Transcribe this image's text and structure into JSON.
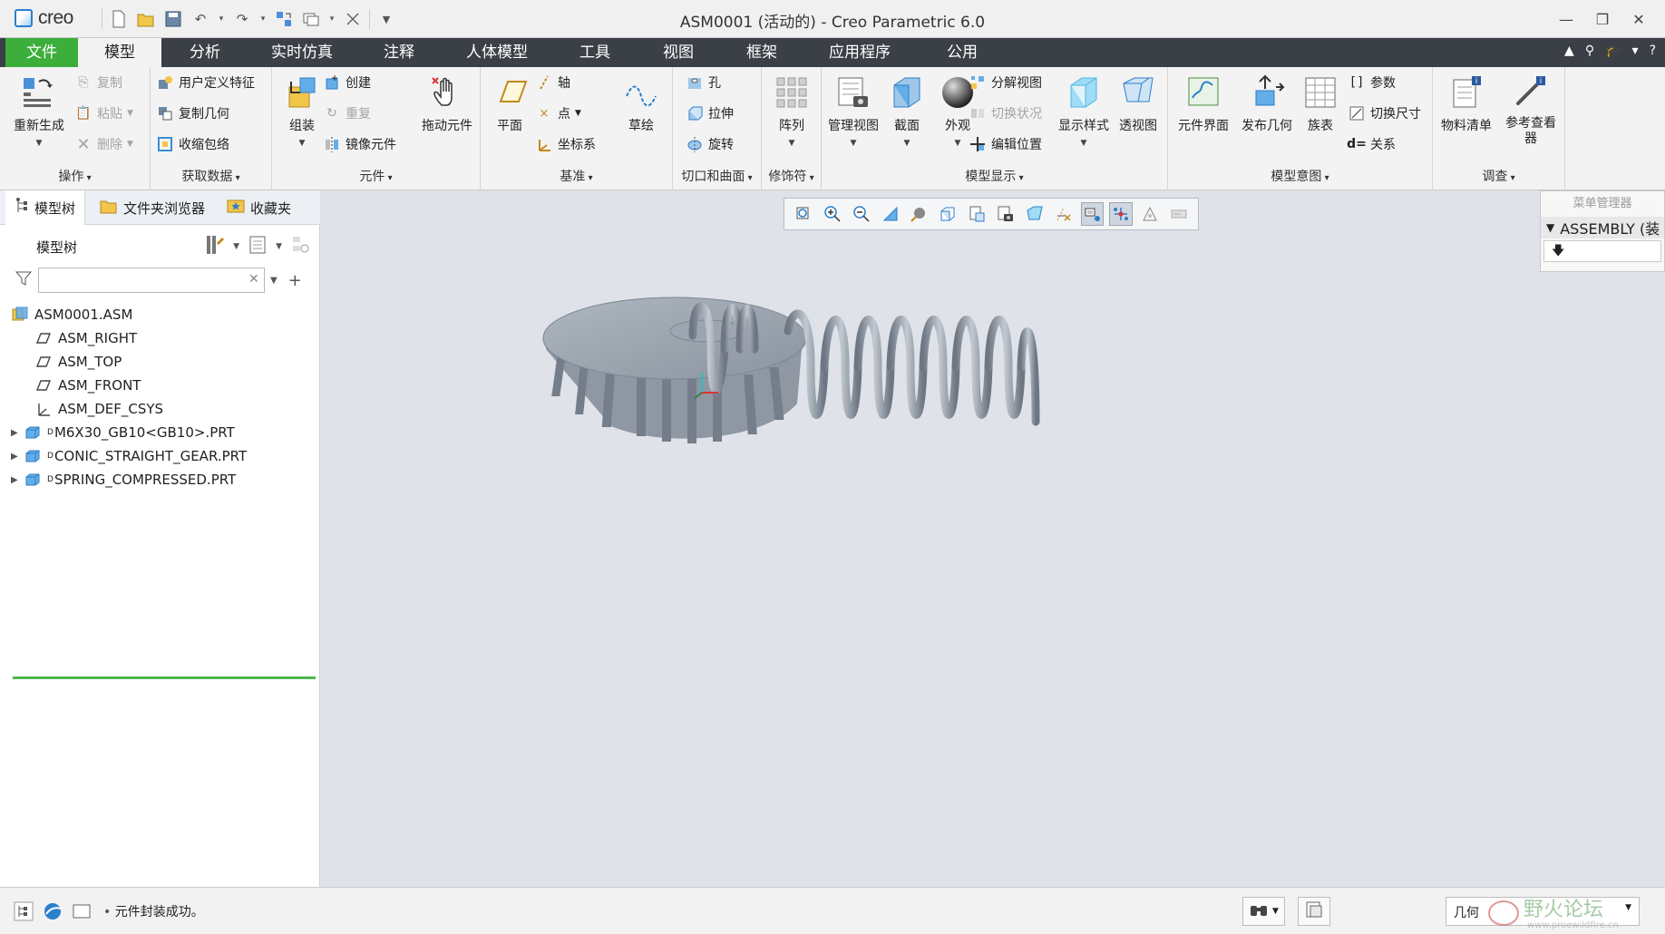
{
  "app": {
    "logo_text": "creo",
    "window_title": "ASM0001 (活动的) - Creo Parametric 6.0"
  },
  "tabs": [
    "文件",
    "模型",
    "分析",
    "实时仿真",
    "注释",
    "人体模型",
    "工具",
    "视图",
    "框架",
    "应用程序",
    "公用"
  ],
  "ribbon": {
    "operations": {
      "label": "操作",
      "regenerate": "重新生成",
      "copy": "复制",
      "paste": "粘贴",
      "delete": "删除"
    },
    "get_data": {
      "label": "获取数据",
      "udf": "用户定义特征",
      "copy_geom": "复制几何",
      "shrinkwrap": "收缩包络"
    },
    "component": {
      "label": "元件",
      "assemble": "组装",
      "create": "创建",
      "repeat": "重复",
      "mirror": "镜像元件",
      "drag": "拖动元件"
    },
    "datum": {
      "label": "基准",
      "plane": "平面",
      "axis": "轴",
      "point": "点",
      "csys": "坐标系",
      "sketch": "草绘"
    },
    "cut_surface": {
      "label": "切口和曲面",
      "hole": "孔",
      "extrude": "拉伸",
      "revolve": "旋转"
    },
    "modifiers": {
      "label": "修饰符",
      "pattern": "阵列"
    },
    "model_display": {
      "label": "模型显示",
      "manage_views": "管理视图",
      "section": "截面",
      "appearance": "外观",
      "explode_view": "分解视图",
      "toggle_status": "切换状况",
      "edit_position": "编辑位置",
      "display_style": "显示样式",
      "perspective": "透视图"
    },
    "model_intent": {
      "label": "模型意图",
      "component_interface": "元件界面",
      "publish_geom": "发布几何",
      "family_table": "族表",
      "parameters": "参数",
      "switch_dims": "切换尺寸",
      "relations": "关系"
    },
    "investigate": {
      "label": "调查",
      "bom": "物料清单",
      "reference_viewer": "参考查看器"
    }
  },
  "left_panel": {
    "tabs": [
      "模型树",
      "文件夹浏览器",
      "收藏夹"
    ],
    "tree_title": "模型树",
    "filter_value": "",
    "tree": [
      {
        "name": "ASM0001.ASM",
        "type": "assembly"
      },
      {
        "name": "ASM_RIGHT",
        "type": "plane"
      },
      {
        "name": "ASM_TOP",
        "type": "plane"
      },
      {
        "name": "ASM_FRONT",
        "type": "plane"
      },
      {
        "name": "ASM_DEF_CSYS",
        "type": "csys"
      },
      {
        "name": "M6X30_GB10<GB10>.PRT",
        "type": "part",
        "marker": "D"
      },
      {
        "name": "CONIC_STRAIGHT_GEAR.PRT",
        "type": "part",
        "marker": "D"
      },
      {
        "name": "SPRING_COMPRESSED.PRT",
        "type": "part",
        "marker": "D"
      }
    ]
  },
  "menu_manager": {
    "title": "菜单管理器",
    "item": "ASSEMBLY (装"
  },
  "status": {
    "message": "元件封装成功。",
    "filter_select": "几何"
  },
  "watermark": {
    "text": "野火论坛",
    "url": "www.proewildfire.cn"
  },
  "colors": {
    "file_tab": "#3cae3c",
    "tab_bar": "#3b4047",
    "viewport_bg": "#dfe2e8",
    "model": "#9aa3ae"
  }
}
